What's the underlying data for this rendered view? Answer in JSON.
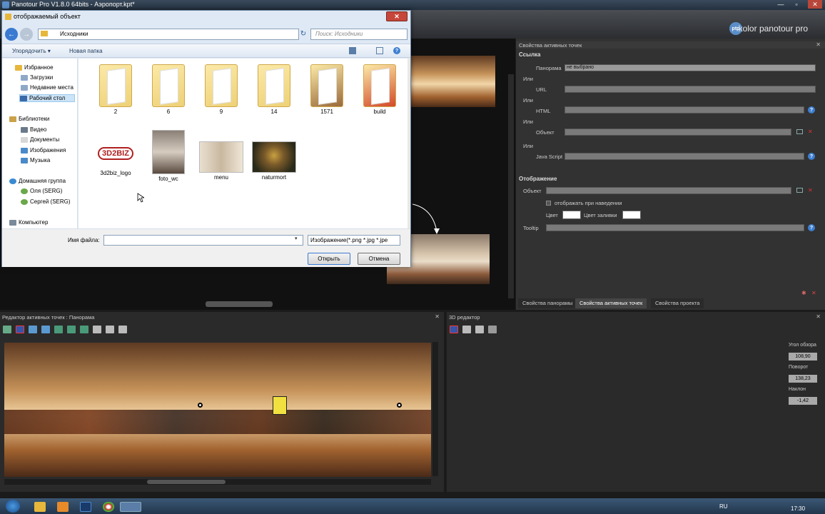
{
  "app": {
    "title": "Panotour Pro V1.8.0 64bits - Аэропорт.kpt*",
    "brand": "kolor panotour pro",
    "brand_logo": "ptp"
  },
  "dialog": {
    "title": "отображаемый объект",
    "address": "Исходники",
    "search_placeholder": "Поиск: Исходники",
    "toolbar": {
      "organize": "Упорядочить ▾",
      "new_folder": "Новая папка"
    },
    "nav": {
      "favorites": "Избранное",
      "downloads": "Загрузки",
      "recent": "Недавние места",
      "desktop": "Рабочий стол",
      "libraries": "Библиотеки",
      "video": "Видео",
      "documents": "Документы",
      "images": "Изображения",
      "music": "Музыка",
      "homegroup": "Домашняя группа",
      "user1": "Оля (SERG)",
      "user2": "Сергей (SERG)",
      "computer": "Компьютер"
    },
    "files": [
      {
        "name": "2"
      },
      {
        "name": "6"
      },
      {
        "name": "9"
      },
      {
        "name": "14"
      },
      {
        "name": "1571"
      },
      {
        "name": "build"
      },
      {
        "name": "3d2biz_logo"
      },
      {
        "name": "foto_wc"
      },
      {
        "name": "menu"
      },
      {
        "name": "naturmort"
      }
    ],
    "logo_text": "3D2BIZ",
    "filename_label": "Имя файла:",
    "filename_value": "",
    "filetype": "Изображение(*.png *.jpg *.jpe",
    "open_button": "Открыть",
    "cancel_button": "Отмена"
  },
  "properties": {
    "title": "Свойства активных точек",
    "link_header": "Ссылка",
    "panorama_label": "Панорама",
    "panorama_value": "не выбрано",
    "or1": "Или",
    "url_label": "URL",
    "or2": "Или",
    "html_label": "HTML",
    "or3": "Или",
    "object_label": "Объект",
    "or4": "Или",
    "js_label": "Java Script",
    "display_header": "Отображение",
    "display_object_label": "Объект",
    "show_on_hover": "отображать при наведении",
    "color_label": "Цвет",
    "fill_color_label": "Цвет заливки",
    "tooltip_label": "Tooltip",
    "tabs": [
      "Свойства панорамы",
      "Свойства активных точек",
      "Свойства проекта"
    ]
  },
  "hotspot_editor": {
    "title": "Редактор активных точек : Панорама"
  },
  "editor3d": {
    "title": "3D редактор",
    "fov_label": "Угол обзора",
    "fov_value": "108,90",
    "rotation_label": "Поворот",
    "rotation_value": "138,23",
    "tilt_label": "Наклон",
    "tilt_value": "-1,42"
  },
  "taskbar": {
    "lang": "RU",
    "time": "17:30"
  },
  "colors": {
    "accent": "#3d7fd1",
    "panel": "#323232",
    "dialog": "#dfe9f5"
  }
}
